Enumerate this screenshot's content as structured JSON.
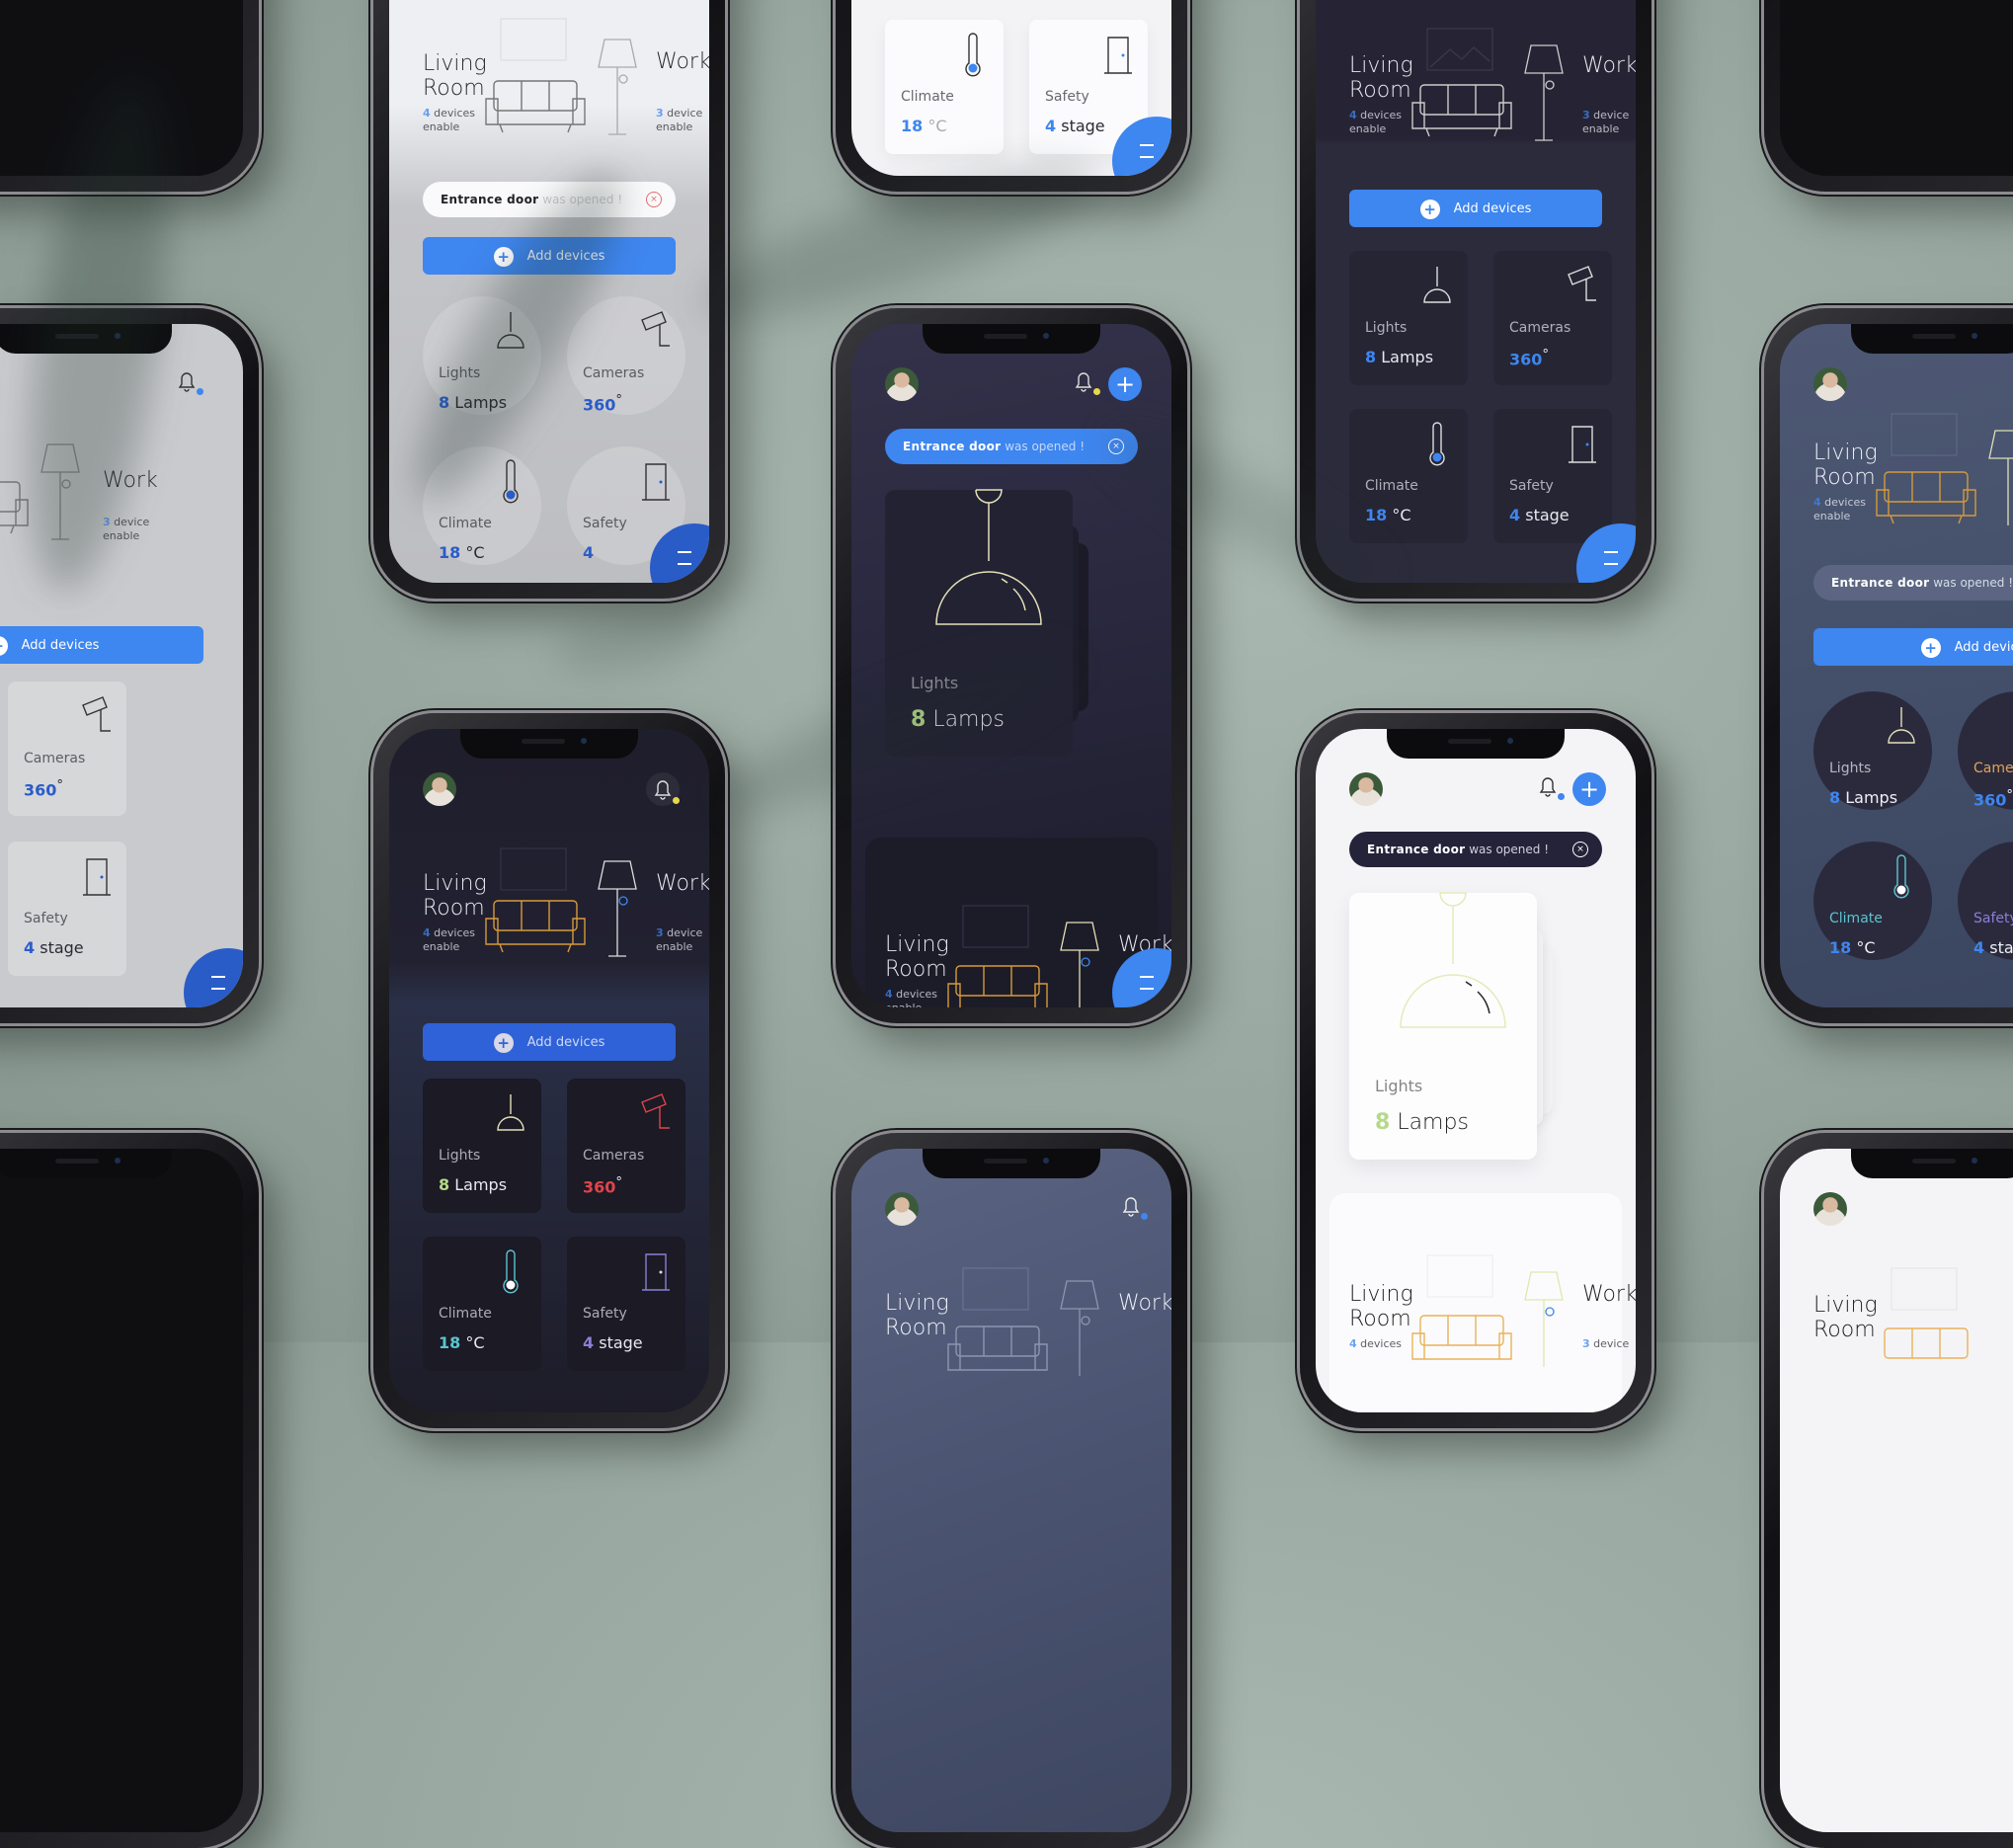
{
  "scene": {
    "description": "Smart home app mockups on multiple phones",
    "background_color": "#9aaaa2",
    "accent_color": "#3e86f0"
  },
  "app": {
    "notification": {
      "bold": "Entrance door",
      "rest": "was opened !"
    },
    "add_devices_label": "Add devices",
    "rooms": [
      {
        "name_line1": "Living",
        "name_line2": "Room",
        "count": "4",
        "sub1": "devices",
        "sub2": "enable"
      },
      {
        "name": "Work",
        "count": "3",
        "sub1": "device",
        "sub2": "enable"
      }
    ],
    "tiles": [
      {
        "label": "Lights",
        "value_num": "8",
        "value_unit": "Lamps",
        "icon": "pendant-lamp-icon"
      },
      {
        "label": "Cameras",
        "value_num": "360",
        "value_unit": "°",
        "icon": "security-camera-icon"
      },
      {
        "label": "Climate",
        "value_num": "18",
        "value_unit": "°C",
        "icon": "thermometer-icon"
      },
      {
        "label": "Safety",
        "value_num": "4",
        "value_unit": "stage",
        "icon": "door-icon"
      }
    ],
    "big_card": {
      "label": "Lights",
      "value_num": "8",
      "value_unit": "Lamps"
    },
    "safety_grey_value": "4",
    "colors": {
      "blue": "#3e86f0",
      "gold": "#d59a3a",
      "green": "#b5d98a",
      "red": "#e0444a",
      "bell_dot_yellow": "#e6d84a",
      "bell_dot_blue": "#3e86f0",
      "teal": "#5cc4cf",
      "violet": "#8a7fd6",
      "orange_label": "#e0a25a"
    }
  }
}
